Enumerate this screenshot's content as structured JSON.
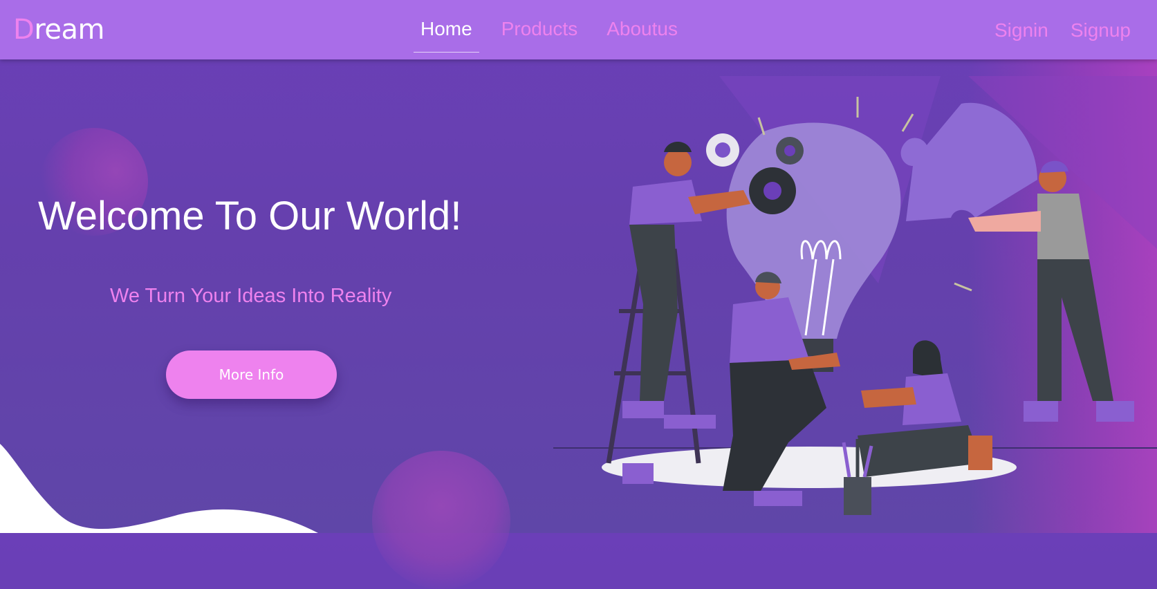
{
  "navbar": {
    "brand_initial": "D",
    "brand_rest": "ream",
    "links": [
      {
        "label": "Home",
        "active": true
      },
      {
        "label": "Products",
        "active": false
      },
      {
        "label": "Aboutus",
        "active": false
      }
    ],
    "signin_label": "Signin",
    "signup_label": "Signup"
  },
  "hero": {
    "title": "Welcome To Our World!",
    "subtitle": "We Turn Your Ideas Into Reality",
    "button_label": "More Info"
  },
  "colors": {
    "navbar_bg": "#a96de8",
    "accent_pink": "#ee82ee",
    "hero_bg": "#6b3fb8",
    "text_white": "#ffffff"
  },
  "illustration": {
    "icon_name": "teamwork-lightbulb-puzzle-illustration"
  }
}
